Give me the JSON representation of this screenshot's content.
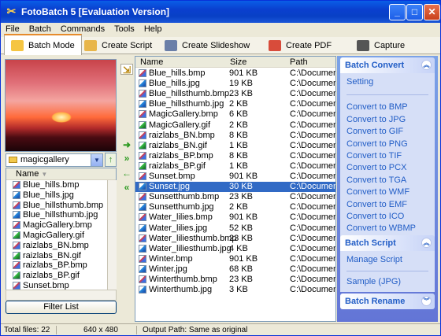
{
  "window": {
    "title": "FotoBatch 5 [Evaluation Version]"
  },
  "menu": [
    "File",
    "Batch",
    "Commands",
    "Tools",
    "Help"
  ],
  "tabs": [
    "Batch Mode",
    "Create Script",
    "Create Slideshow",
    "Create PDF",
    "Capture"
  ],
  "left": {
    "folder": "magicgallery",
    "column_header": "Name",
    "files": [
      {
        "name": "Blue_hills.bmp",
        "type": "bmp"
      },
      {
        "name": "Blue_hills.jpg",
        "type": "jpg"
      },
      {
        "name": "Blue_hillsthumb.bmp",
        "type": "bmp"
      },
      {
        "name": "Blue_hillsthumb.jpg",
        "type": "jpg"
      },
      {
        "name": "MagicGallery.bmp",
        "type": "bmp"
      },
      {
        "name": "MagicGallery.gif",
        "type": "gif"
      },
      {
        "name": "raizlabs_BN.bmp",
        "type": "bmp"
      },
      {
        "name": "raizlabs_BN.gif",
        "type": "gif"
      },
      {
        "name": "raizlabs_BP.bmp",
        "type": "bmp"
      },
      {
        "name": "raizlabs_BP.gif",
        "type": "gif"
      },
      {
        "name": "Sunset.bmp",
        "type": "bmp"
      },
      {
        "name": "Sunset.jpg",
        "type": "jpg"
      }
    ],
    "filter_button": "Filter List"
  },
  "main": {
    "headers": {
      "name": "Name",
      "size": "Size",
      "path": "Path"
    },
    "rows": [
      {
        "name": "Blue_hills.bmp",
        "size": "901 KB",
        "path": "C:\\Documen...",
        "selected": false
      },
      {
        "name": "Blue_hills.jpg",
        "size": "19 KB",
        "path": "C:\\Documen...",
        "selected": false
      },
      {
        "name": "Blue_hillsthumb.bmp",
        "size": "23 KB",
        "path": "C:\\Documen...",
        "selected": false
      },
      {
        "name": "Blue_hillsthumb.jpg",
        "size": "2 KB",
        "path": "C:\\Documen...",
        "selected": false
      },
      {
        "name": "MagicGallery.bmp",
        "size": "6 KB",
        "path": "C:\\Documen...",
        "selected": false
      },
      {
        "name": "MagicGallery.gif",
        "size": "2 KB",
        "path": "C:\\Documen...",
        "selected": false
      },
      {
        "name": "raizlabs_BN.bmp",
        "size": "8 KB",
        "path": "C:\\Documen...",
        "selected": false
      },
      {
        "name": "raizlabs_BN.gif",
        "size": "1 KB",
        "path": "C:\\Documen...",
        "selected": false
      },
      {
        "name": "raizlabs_BP.bmp",
        "size": "8 KB",
        "path": "C:\\Documen...",
        "selected": false
      },
      {
        "name": "raizlabs_BP.gif",
        "size": "1 KB",
        "path": "C:\\Documen...",
        "selected": false
      },
      {
        "name": "Sunset.bmp",
        "size": "901 KB",
        "path": "C:\\Documen...",
        "selected": false
      },
      {
        "name": "Sunset.jpg",
        "size": "30 KB",
        "path": "C:\\Documen...",
        "selected": true
      },
      {
        "name": "Sunsetthumb.bmp",
        "size": "23 KB",
        "path": "C:\\Documen...",
        "selected": false
      },
      {
        "name": "Sunsetthumb.jpg",
        "size": "2 KB",
        "path": "C:\\Documen...",
        "selected": false
      },
      {
        "name": "Water_lilies.bmp",
        "size": "901 KB",
        "path": "C:\\Documen...",
        "selected": false
      },
      {
        "name": "Water_lilies.jpg",
        "size": "52 KB",
        "path": "C:\\Documen...",
        "selected": false
      },
      {
        "name": "Water_liliesthumb.bmp",
        "size": "23 KB",
        "path": "C:\\Documen...",
        "selected": false
      },
      {
        "name": "Water_liliesthumb.jpg",
        "size": "4 KB",
        "path": "C:\\Documen...",
        "selected": false
      },
      {
        "name": "Winter.bmp",
        "size": "901 KB",
        "path": "C:\\Documen...",
        "selected": false
      },
      {
        "name": "Winter.jpg",
        "size": "68 KB",
        "path": "C:\\Documen...",
        "selected": false
      },
      {
        "name": "Winterthumb.bmp",
        "size": "23 KB",
        "path": "C:\\Documen...",
        "selected": false
      },
      {
        "name": "Winterthumb.jpg",
        "size": "3 KB",
        "path": "C:\\Documen...",
        "selected": false
      }
    ]
  },
  "panel": {
    "batch_convert": {
      "title": "Batch Convert",
      "setting": "Setting",
      "links": [
        "Convert to BMP",
        "Convert to JPG",
        "Convert to GIF",
        "Convert to PNG",
        "Convert to TIF",
        "Convert to PCX",
        "Convert to TGA",
        "Convert to WMF",
        "Convert to EMF",
        "Convert to ICO",
        "Convert to WBMP"
      ]
    },
    "batch_script": {
      "title": "Batch Script",
      "links": [
        "Manage Script",
        "Sample (JPG)"
      ]
    },
    "batch_rename": {
      "title": "Batch Rename"
    }
  },
  "status": {
    "total": "Total files: 22",
    "dims": "640 x 480",
    "output": "Output Path: Same as original"
  },
  "colors": {
    "title_bar": "#0a50d8",
    "selection": "#316ac5",
    "panel_bg": "#7090e0",
    "link": "#215dc6"
  }
}
